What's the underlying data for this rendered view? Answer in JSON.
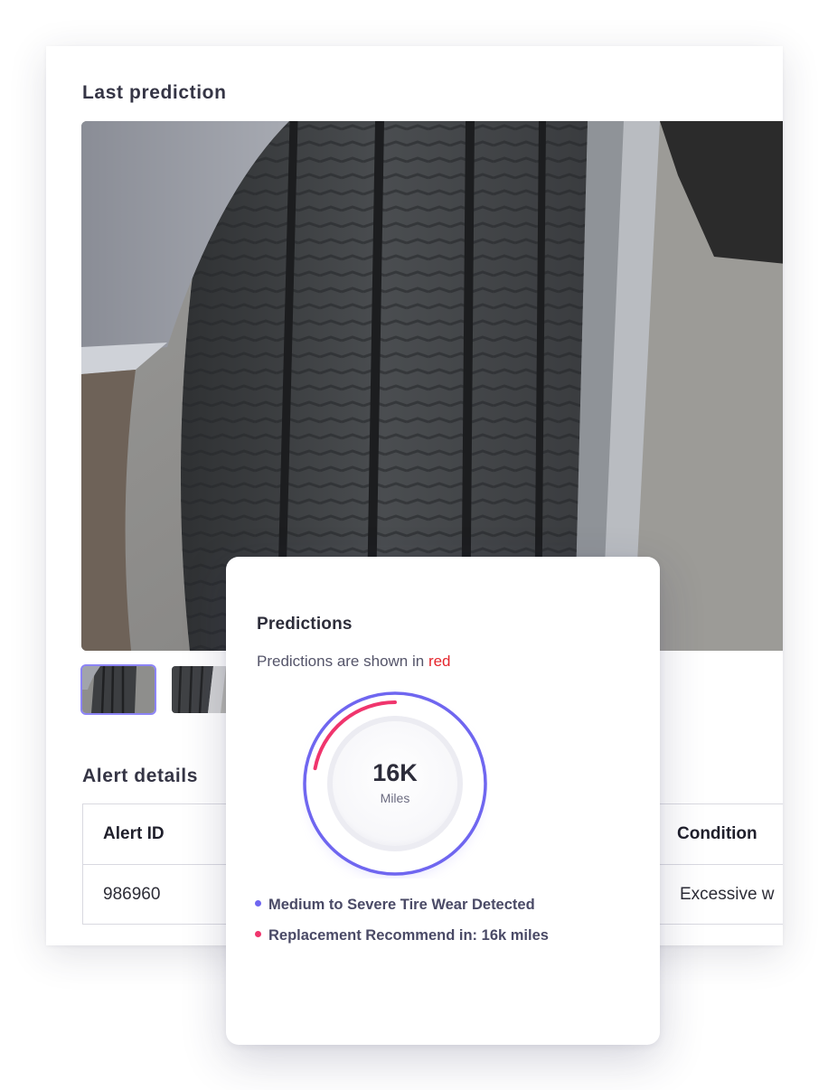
{
  "last_prediction": {
    "title": "Last prediction",
    "photo_icon": "tire-photo",
    "thumbnails": [
      {
        "icon": "tire-thumbnail",
        "selected": true
      },
      {
        "icon": "tire-thumbnail",
        "selected": false
      }
    ]
  },
  "alert_details": {
    "title": "Alert details",
    "columns": [
      "Alert ID",
      "Condition"
    ],
    "row": {
      "alert_id": "986960",
      "condition": "Excessive w"
    }
  },
  "predictions": {
    "title": "Predictions",
    "subtitle_prefix": "Predictions are shown in ",
    "subtitle_highlight": "red",
    "gauge": {
      "value": "16K",
      "unit": "Miles",
      "progress_fraction": 0.22,
      "ring_color": "#6f66f0",
      "progress_color": "#f0356d"
    },
    "findings": [
      {
        "text": "Medium to Severe Tire Wear Detected",
        "color": "#6f66f0"
      },
      {
        "text": "Replacement Recommend in: 16k miles",
        "color": "#f0356d"
      }
    ]
  },
  "colors": {
    "accent": "#6f66f0",
    "alert_red": "#e5262d",
    "text_primary": "#2d2d3a"
  }
}
